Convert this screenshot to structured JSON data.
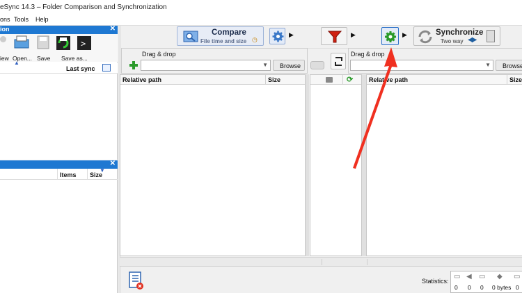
{
  "window": {
    "title": "eSync 14.3 – Folder Comparison and Synchronization"
  },
  "menu": {
    "items": [
      "ons",
      "Tools",
      "Help"
    ]
  },
  "config_panel": {
    "header": "ion",
    "buttons": [
      "iew",
      "Open...",
      "Save",
      "Save as..."
    ],
    "col_last_sync": "Last sync"
  },
  "overview_panel": {
    "col_items": "Items",
    "col_size": "Size"
  },
  "compare": {
    "label": "Compare",
    "sublabel": "File time and size"
  },
  "synchronize": {
    "label": "Synchronize",
    "sublabel": "Two way"
  },
  "left_folder": {
    "drag_drop": "Drag & drop",
    "browse": "Browse"
  },
  "right_folder": {
    "drag_drop": "Drag & drop",
    "browse": "Browse"
  },
  "left_grid": {
    "col_path": "Relative path",
    "col_size": "Size"
  },
  "right_grid": {
    "col_path": "Relative path",
    "col_size": "Size"
  },
  "statistics": {
    "label": "Statistics:",
    "values": [
      "0",
      "0",
      "0",
      "0 bytes",
      "0"
    ]
  },
  "colors": {
    "accent": "#1e78d2",
    "annotation_arrow": "#f03020",
    "filter_red": "#d02010",
    "gear_green": "#2a9a2a"
  }
}
